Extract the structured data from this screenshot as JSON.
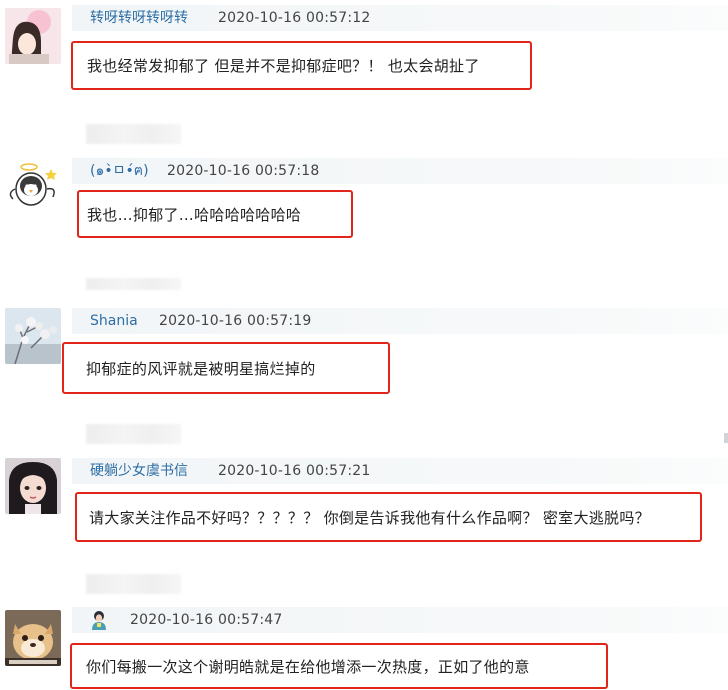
{
  "comments": [
    {
      "username": "转呀转呀转呀转",
      "timestamp": "2020-10-16 00:57:12",
      "text": "我也经常发抑郁了 但是并不是抑郁症吧？！ 也太会胡扯了"
    },
    {
      "username": "(๑•̀ㅁ•́ฅ)",
      "timestamp": "2020-10-16 00:57:18",
      "text": "我也…抑郁了…哈哈哈哈哈哈哈"
    },
    {
      "username": "Shania",
      "timestamp": "2020-10-16 00:57:19",
      "text": "抑郁症的风评就是被明星搞烂掉的"
    },
    {
      "username": "硬躺少女虞书信",
      "timestamp": "2020-10-16 00:57:21",
      "text": "请大家关注作品不好吗？？？？？ 你倒是告诉我他有什么作品啊？ 密室大逃脱吗？"
    },
    {
      "username": "",
      "timestamp": "2020-10-16 00:57:47",
      "text": "你们每搬一次这个谢明皓就是在给他增添一次热度，正如了他的意"
    }
  ],
  "colors": {
    "highlight_border": "#e1251b",
    "username": "#2d6ea5",
    "header_bg": "#f2f5f7"
  }
}
